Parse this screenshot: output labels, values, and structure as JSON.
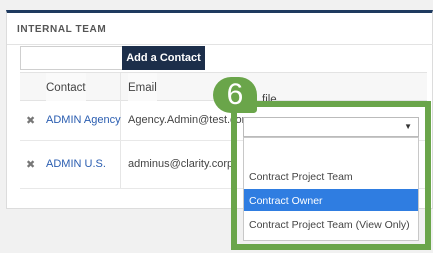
{
  "panel": {
    "title": "INTERNAL TEAM"
  },
  "toolbar": {
    "add_contact_label": "Add a Contact",
    "contact_input_value": ""
  },
  "table": {
    "columns": [
      "Contact",
      "Email",
      "Profile"
    ],
    "profile_header_visible": "file",
    "rows": [
      {
        "contact": "ADMIN Agency",
        "email": "Agency.Admin@test.com",
        "email_visible": "Agency.Admin@test.cor"
      },
      {
        "contact": "ADMIN U.S.",
        "email": "adminus@clarity.corp"
      }
    ]
  },
  "profile_select": {
    "value": "",
    "options": [
      "",
      "Contract Project Team",
      "Contract Owner",
      "Contract Project Team (View Only)"
    ],
    "highlighted": "Contract Owner"
  },
  "callout": {
    "number": "6",
    "color": "#6aa54a"
  },
  "colors": {
    "header_bar": "#1e3a5f",
    "button": "#1c2e4a",
    "selection": "#2f7de1",
    "link": "#2a5db0"
  },
  "icons": {
    "remove_row": "close-icon",
    "select_caret": "caret-down-icon"
  }
}
